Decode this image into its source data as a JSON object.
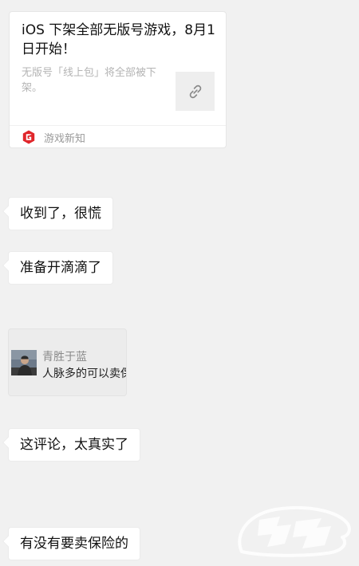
{
  "card": {
    "title": "iOS 下架全部无版号游戏，8月1日开始！",
    "description": "无版号「线上包」将全部被下架。",
    "link_icon": "link-icon",
    "source_icon": "gamesnews-logo-icon",
    "source_label": "游戏新知",
    "source_color": "#e0262b"
  },
  "messages": [
    {
      "text": "收到了，很慌"
    },
    {
      "text": "准备开滴滴了"
    },
    {
      "text": "这评论，太真实了"
    },
    {
      "text": "有没有要卖保险的"
    }
  ],
  "quote": {
    "author": "青胜于蓝",
    "text": "人脉多的可以卖保险",
    "avatar_icon": "user-avatar"
  },
  "watermark": {
    "icon": "watermark-logo",
    "color": "#ffffff"
  }
}
